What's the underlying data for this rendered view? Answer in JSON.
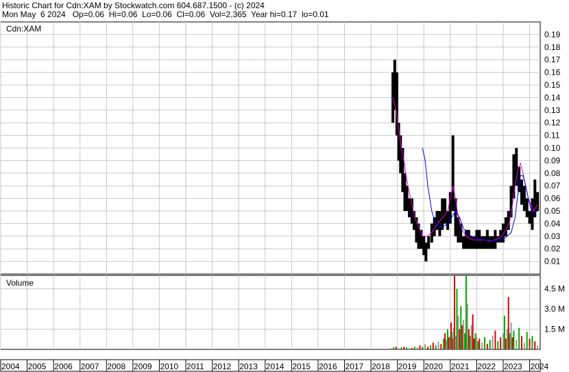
{
  "header": {
    "line1": "Historic Chart for Cdn:XAM by Stockwatch.com 604.687.1500 - (c) 2024",
    "line2": "Mon May  6 2024   Op=0.06  Hi=0.06  Lo=0.06  Cl=0.06  Vol=2,365  Year hi=0.17  lo=0.01"
  },
  "chart_data": [
    {
      "type": "line",
      "panel": "price",
      "symbol_label": "Cdn:XAM",
      "x_ticks": [
        "2004",
        "2005",
        "2006",
        "2007",
        "2008",
        "2009",
        "2010",
        "2011",
        "2012",
        "2013",
        "2014",
        "2015",
        "2016",
        "2017",
        "2018",
        "2019",
        "2020",
        "2021",
        "2022",
        "2023",
        "2024"
      ],
      "y_ticks": [
        "0.19",
        "0.18",
        "0.17",
        "0.16",
        "0.15",
        "0.14",
        "0.13",
        "0.12",
        "0.11",
        "0.10",
        "0.09",
        "0.08",
        "0.07",
        "0.06",
        "0.05",
        "0.04",
        "0.03",
        "0.02",
        "0.01"
      ],
      "ylim": [
        0,
        0.2
      ],
      "xlim": [
        2004,
        2024.4
      ],
      "grid": true,
      "colors": {
        "price": "#000000",
        "ma_short": "#dd00dd",
        "ma_long": "#0000ee",
        "grid": "#c8c8c8"
      },
      "series": [
        {
          "role": "price_bars",
          "x": [
            2018.83,
            2018.9,
            2018.98,
            2019.05,
            2019.12,
            2019.2,
            2019.28,
            2019.36,
            2019.45,
            2019.55,
            2019.63,
            2019.72,
            2019.8,
            2019.9,
            2020.0,
            2020.08,
            2020.18,
            2020.3,
            2020.4,
            2020.5,
            2020.6,
            2020.7,
            2020.8,
            2020.9,
            2021.0,
            2021.1,
            2021.2,
            2021.3,
            2021.4,
            2021.5,
            2021.6,
            2021.7,
            2021.8,
            2021.9,
            2022.0,
            2022.1,
            2022.2,
            2022.3,
            2022.4,
            2022.5,
            2022.6,
            2022.7,
            2022.8,
            2022.9,
            2023.0,
            2023.1,
            2023.2,
            2023.3,
            2023.4,
            2023.5,
            2023.6,
            2023.7,
            2023.8,
            2023.9,
            2024.0,
            2024.1,
            2024.2,
            2024.3
          ],
          "high": [
            0.16,
            0.17,
            0.16,
            0.12,
            0.11,
            0.1,
            0.08,
            0.07,
            0.06,
            0.06,
            0.05,
            0.045,
            0.04,
            0.035,
            0.03,
            0.025,
            0.03,
            0.04,
            0.045,
            0.05,
            0.05,
            0.06,
            0.06,
            0.05,
            0.065,
            0.11,
            0.06,
            0.045,
            0.04,
            0.03,
            0.035,
            0.035,
            0.03,
            0.03,
            0.035,
            0.035,
            0.03,
            0.03,
            0.035,
            0.03,
            0.03,
            0.035,
            0.03,
            0.035,
            0.04,
            0.045,
            0.05,
            0.07,
            0.095,
            0.1,
            0.085,
            0.075,
            0.07,
            0.06,
            0.05,
            0.06,
            0.075,
            0.065
          ],
          "low": [
            0.12,
            0.13,
            0.11,
            0.09,
            0.08,
            0.065,
            0.05,
            0.05,
            0.045,
            0.04,
            0.035,
            0.025,
            0.02,
            0.02,
            0.015,
            0.01,
            0.02,
            0.025,
            0.03,
            0.035,
            0.03,
            0.035,
            0.04,
            0.035,
            0.04,
            0.05,
            0.03,
            0.025,
            0.025,
            0.02,
            0.02,
            0.02,
            0.02,
            0.02,
            0.02,
            0.02,
            0.02,
            0.02,
            0.02,
            0.02,
            0.02,
            0.02,
            0.025,
            0.025,
            0.025,
            0.03,
            0.035,
            0.045,
            0.06,
            0.07,
            0.065,
            0.055,
            0.05,
            0.045,
            0.04,
            0.035,
            0.045,
            0.05
          ]
        },
        {
          "role": "ma_short",
          "x": [
            2018.83,
            2018.95,
            2019.05,
            2019.15,
            2019.25,
            2019.35,
            2019.45,
            2019.55,
            2019.65,
            2019.75,
            2019.85,
            2019.95,
            2020.05,
            2020.15,
            2020.3,
            2020.45,
            2020.6,
            2020.75,
            2020.9,
            2021.0,
            2021.1,
            2021.2,
            2021.3,
            2021.45,
            2021.6,
            2021.75,
            2021.9,
            2022.05,
            2022.2,
            2022.35,
            2022.5,
            2022.65,
            2022.8,
            2022.95,
            2023.1,
            2023.25,
            2023.35,
            2023.45,
            2023.55,
            2023.65,
            2023.75,
            2023.85,
            2023.95,
            2024.05,
            2024.15,
            2024.3
          ],
          "values": [
            0.14,
            0.13,
            0.115,
            0.1,
            0.09,
            0.075,
            0.065,
            0.055,
            0.045,
            0.04,
            0.035,
            0.03,
            0.03,
            0.03,
            0.033,
            0.038,
            0.042,
            0.046,
            0.05,
            0.06,
            0.07,
            0.06,
            0.045,
            0.035,
            0.03,
            0.028,
            0.027,
            0.027,
            0.027,
            0.027,
            0.026,
            0.027,
            0.028,
            0.03,
            0.035,
            0.042,
            0.055,
            0.07,
            0.082,
            0.088,
            0.08,
            0.07,
            0.06,
            0.055,
            0.05,
            0.055
          ]
        },
        {
          "role": "ma_long",
          "x": [
            2019.95,
            2020.05,
            2020.15,
            2020.3,
            2020.45,
            2020.6,
            2020.75,
            2020.9,
            2021.05,
            2021.2,
            2021.35,
            2021.5,
            2021.7,
            2021.9,
            2022.1,
            2022.3,
            2022.5,
            2022.7,
            2022.9,
            2023.1,
            2023.3,
            2023.45,
            2023.55,
            2023.65,
            2023.75,
            2023.85,
            2023.95,
            2024.05,
            2024.15,
            2024.3
          ],
          "values": [
            0.1,
            0.09,
            0.07,
            0.05,
            0.04,
            0.037,
            0.038,
            0.04,
            0.045,
            0.05,
            0.045,
            0.036,
            0.031,
            0.029,
            0.028,
            0.027,
            0.027,
            0.026,
            0.027,
            0.029,
            0.033,
            0.045,
            0.062,
            0.078,
            0.078,
            0.07,
            0.06,
            0.052,
            0.048,
            0.05
          ]
        }
      ]
    },
    {
      "type": "bar",
      "panel": "volume",
      "title": "Volume",
      "y_ticks": [
        "4.5 M",
        "3.0 M",
        "1.5 M"
      ],
      "ylim": [
        0,
        5.5
      ],
      "colors": {
        "up": "#00aa00",
        "down": "#dd0000",
        "flat": "#999999"
      },
      "x": [
        2018.75,
        2018.85,
        2018.95,
        2019.05,
        2019.15,
        2019.25,
        2019.35,
        2019.45,
        2019.55,
        2019.65,
        2019.75,
        2019.85,
        2019.95,
        2020.05,
        2020.15,
        2020.25,
        2020.35,
        2020.45,
        2020.55,
        2020.65,
        2020.75,
        2020.8,
        2020.85,
        2020.9,
        2020.95,
        2021.0,
        2021.03,
        2021.06,
        2021.1,
        2021.13,
        2021.16,
        2021.2,
        2021.25,
        2021.3,
        2021.35,
        2021.4,
        2021.45,
        2021.5,
        2021.55,
        2021.6,
        2021.65,
        2021.7,
        2021.75,
        2021.8,
        2021.85,
        2021.9,
        2021.95,
        2022.0,
        2022.05,
        2022.1,
        2022.2,
        2022.3,
        2022.4,
        2022.5,
        2022.6,
        2022.7,
        2022.8,
        2022.9,
        2023.0,
        2023.05,
        2023.1,
        2023.15,
        2023.2,
        2023.25,
        2023.3,
        2023.35,
        2023.4,
        2023.5,
        2023.6,
        2023.7,
        2023.8,
        2023.9,
        2024.0,
        2024.1,
        2024.2,
        2024.3
      ],
      "values": [
        0.1,
        0.15,
        0.2,
        0.1,
        0.15,
        0.2,
        0.15,
        0.1,
        0.1,
        0.2,
        0.15,
        0.3,
        0.2,
        0.4,
        0.2,
        0.3,
        0.5,
        0.3,
        0.6,
        0.4,
        0.8,
        1.2,
        0.7,
        1.5,
        0.9,
        1.0,
        2.0,
        1.3,
        0.8,
        1.6,
        5.5,
        1.0,
        4.5,
        2.5,
        1.5,
        3.2,
        1.8,
        2.2,
        1.2,
        5.8,
        3.4,
        1.5,
        1.0,
        1.8,
        2.6,
        0.8,
        1.2,
        0.9,
        0.6,
        0.8,
        0.5,
        0.9,
        0.4,
        0.7,
        1.0,
        1.4,
        0.6,
        0.9,
        1.2,
        2.5,
        0.8,
        1.5,
        3.9,
        1.2,
        2.0,
        0.9,
        1.4,
        0.7,
        1.6,
        1.0,
        0.5,
        1.3,
        0.8,
        1.0,
        0.6,
        0.3
      ],
      "dirs": [
        "f",
        "u",
        "d",
        "f",
        "u",
        "d",
        "u",
        "f",
        "d",
        "u",
        "f",
        "d",
        "u",
        "f",
        "d",
        "u",
        "d",
        "u",
        "f",
        "d",
        "u",
        "d",
        "f",
        "u",
        "d",
        "f",
        "d",
        "u",
        "d",
        "f",
        "d",
        "f",
        "u",
        "f",
        "d",
        "u",
        "d",
        "f",
        "u",
        "u",
        "f",
        "d",
        "u",
        "f",
        "d",
        "d",
        "u",
        "f",
        "u",
        "d",
        "f",
        "u",
        "d",
        "u",
        "f",
        "d",
        "u",
        "d",
        "f",
        "u",
        "d",
        "f",
        "d",
        "u",
        "f",
        "d",
        "u",
        "f",
        "u",
        "d",
        "f",
        "u",
        "d",
        "u",
        "d",
        "f"
      ]
    }
  ]
}
